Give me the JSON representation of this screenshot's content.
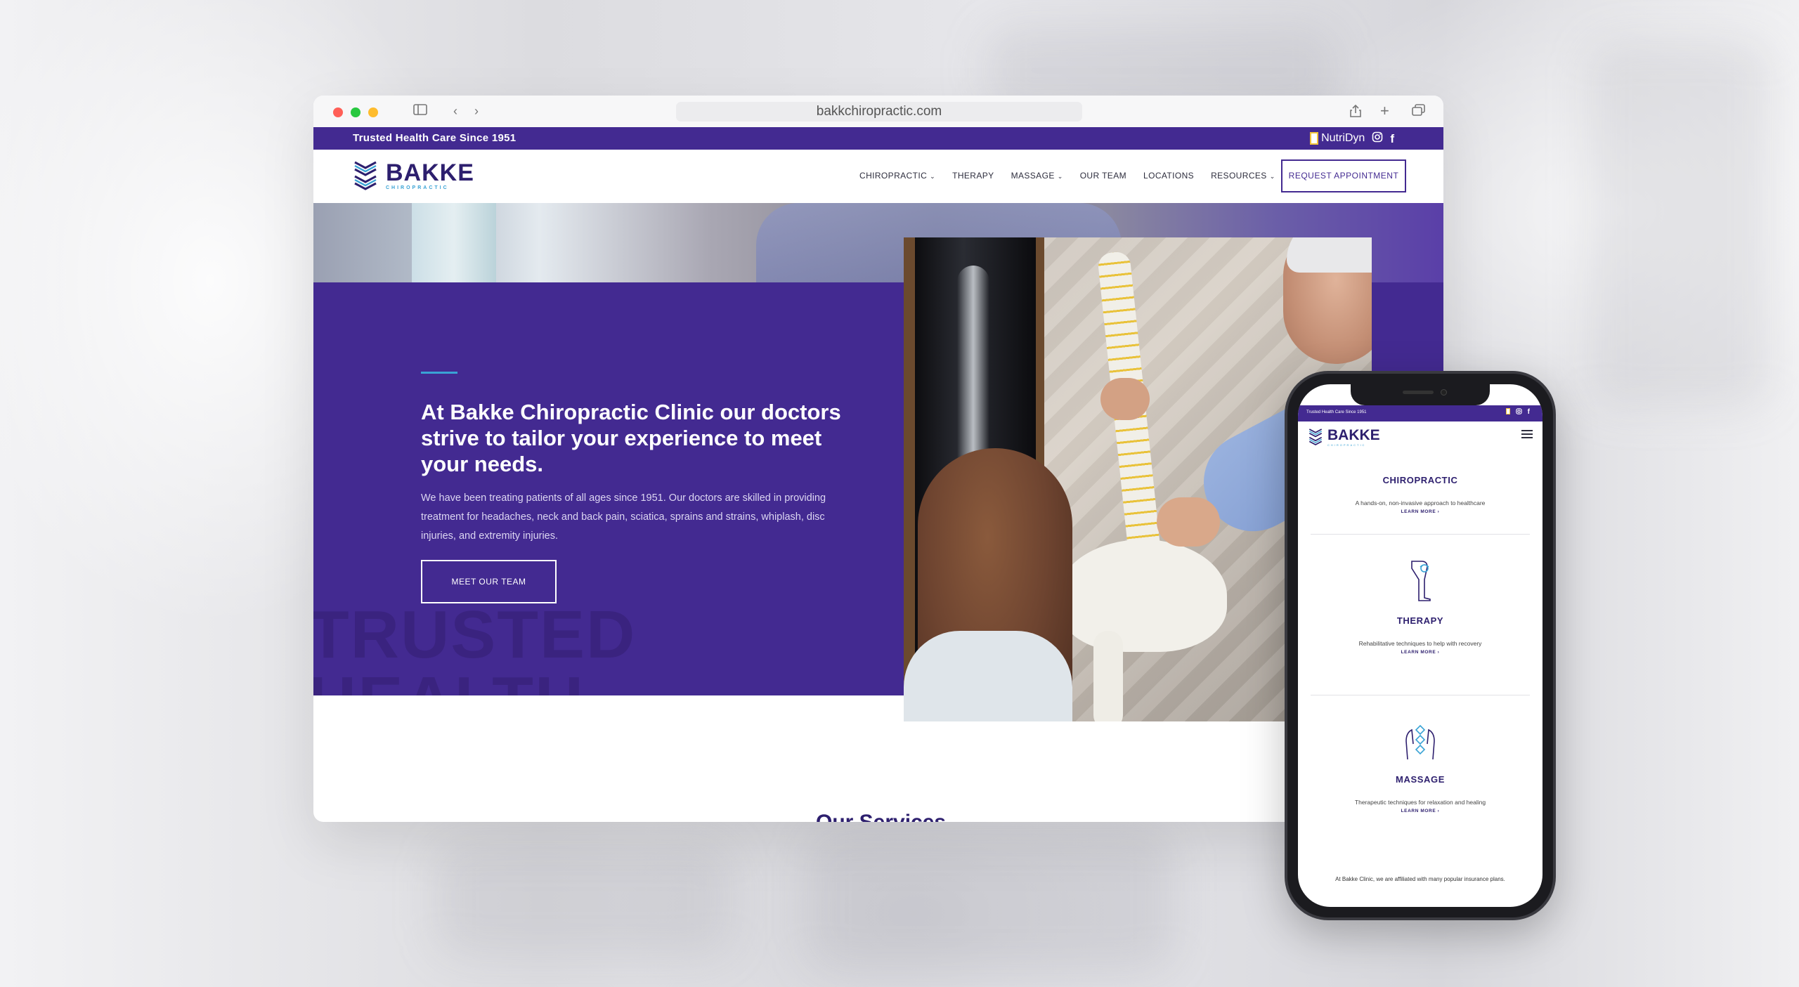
{
  "browser": {
    "url": "bakkchiropractic.com",
    "traffic_lights": [
      "#ff5f57",
      "#28c840",
      "#febc2e"
    ]
  },
  "site": {
    "tagline": "Trusted Health Care Since 1951",
    "partner": "NutriDyn",
    "social": [
      "instagram-icon",
      "facebook-icon"
    ],
    "logo": {
      "name": "BAKKE",
      "sub": "CHIROPRACTIC"
    },
    "nav": [
      {
        "label": "CHIROPRACTIC",
        "dropdown": true
      },
      {
        "label": "THERAPY",
        "dropdown": false
      },
      {
        "label": "MASSAGE",
        "dropdown": true
      },
      {
        "label": "OUR TEAM",
        "dropdown": false
      },
      {
        "label": "LOCATIONS",
        "dropdown": false
      },
      {
        "label": "RESOURCES",
        "dropdown": true
      }
    ],
    "cta": "REQUEST APPOINTMENT",
    "colors": {
      "brand": "#432a91",
      "accent": "#3aa3d5"
    }
  },
  "hero": {
    "headline": "At Bakke Chiropractic Clinic our doctors strive to tailor your experience to meet your needs.",
    "body": "We have been treating patients of all ages since 1951. Our doctors are skilled in providing treatment for headaches, neck and back pain, sciatica, sprains and strains, whiplash, disc injuries, and extremity injuries.",
    "button": "MEET OUR TEAM",
    "watermark_line1": "TRUSTED",
    "watermark_line2": "HEALTH"
  },
  "services_section": {
    "title": "Our Services"
  },
  "phone": {
    "tagline": "Trusted Health Care Since 1951",
    "logo": {
      "name": "BAKKE",
      "sub": "CHIROPRACTIC"
    },
    "services": [
      {
        "name": "CHIROPRACTIC",
        "desc": "A hands-on, non-invasive approach to healthcare",
        "more": "LEARN MORE ›"
      },
      {
        "name": "THERAPY",
        "desc": "Rehabilitative techniques to help with recovery",
        "more": "LEARN MORE ›"
      },
      {
        "name": "MASSAGE",
        "desc": "Therapeutic techniques for relaxation and healing",
        "more": "LEARN MORE ›"
      }
    ],
    "insurance": "At Bakke Clinic, we are affiliated with many popular insurance plans."
  }
}
